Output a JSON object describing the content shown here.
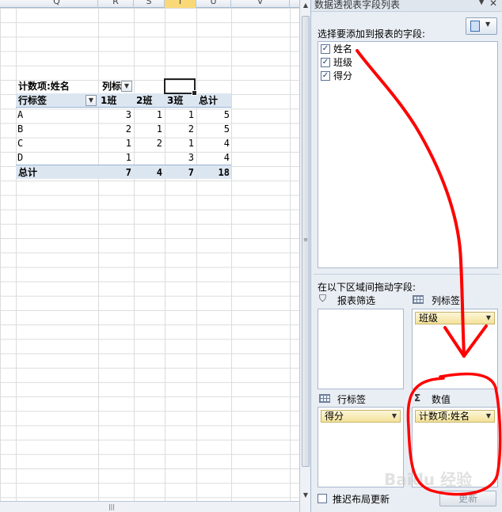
{
  "sheet": {
    "columns": [
      {
        "label": "Q",
        "selected": false
      },
      {
        "label": "R",
        "selected": false
      },
      {
        "label": "S",
        "selected": false
      },
      {
        "label": "T",
        "selected": true
      },
      {
        "label": "U",
        "selected": false
      },
      {
        "label": "V",
        "selected": false
      }
    ]
  },
  "pivot": {
    "data_field_label": "计数项:姓名",
    "column_labels": "列标",
    "row_labels": "行标签",
    "col_headers": [
      "1班",
      "2班",
      "3班",
      "总计"
    ],
    "rows": [
      {
        "label": "A",
        "values": [
          "3",
          "1",
          "1",
          "5"
        ]
      },
      {
        "label": "B",
        "values": [
          "2",
          "1",
          "2",
          "5"
        ]
      },
      {
        "label": "C",
        "values": [
          "1",
          "2",
          "1",
          "4"
        ]
      },
      {
        "label": "D",
        "values": [
          "1",
          "",
          "3",
          "4"
        ]
      }
    ],
    "total": {
      "label": "总计",
      "values": [
        "7",
        "4",
        "7",
        "18"
      ]
    }
  },
  "pane": {
    "title": "数据透视表字段列表",
    "choose_label": "选择要添加到报表的字段:",
    "fields": [
      {
        "label": "姓名",
        "checked": true
      },
      {
        "label": "班级",
        "checked": true
      },
      {
        "label": "得分",
        "checked": true
      }
    ],
    "drag_label": "在以下区域间拖动字段:",
    "areas": {
      "report_filter": {
        "title": "报表筛选"
      },
      "column_labels": {
        "title": "列标签",
        "chip": "班级"
      },
      "row_labels": {
        "title": "行标签",
        "chip": "得分"
      },
      "values": {
        "title": "数值",
        "chip": "计数项:姓名"
      }
    },
    "defer_label": "推迟布局更新",
    "update_label": "更新"
  },
  "annotation": {
    "color": "#ff0000"
  },
  "watermark": "Baidu 经验"
}
